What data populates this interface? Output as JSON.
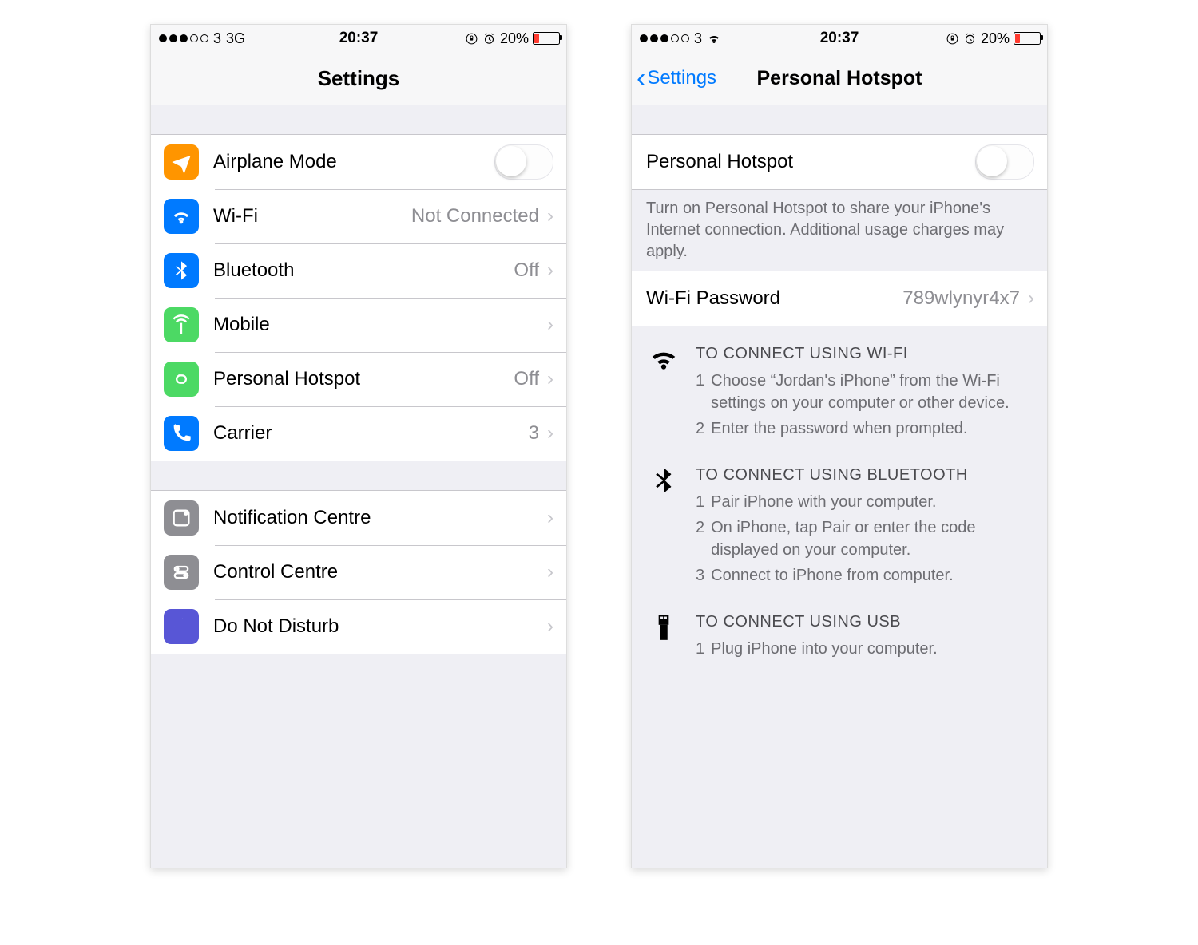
{
  "status": {
    "carrier": "3",
    "network": "3G",
    "time": "20:37",
    "battery_text": "20%"
  },
  "left": {
    "title": "Settings",
    "group1": [
      {
        "label": "Airplane Mode",
        "detail": "",
        "toggle": true
      },
      {
        "label": "Wi-Fi",
        "detail": "Not Connected"
      },
      {
        "label": "Bluetooth",
        "detail": "Off"
      },
      {
        "label": "Mobile",
        "detail": ""
      },
      {
        "label": "Personal Hotspot",
        "detail": "Off"
      },
      {
        "label": "Carrier",
        "detail": "3"
      }
    ],
    "group2": [
      {
        "label": "Notification Centre"
      },
      {
        "label": "Control Centre"
      },
      {
        "label": "Do Not Disturb"
      }
    ]
  },
  "right": {
    "back": "Settings",
    "title": "Personal Hotspot",
    "toggle_row": "Personal Hotspot",
    "footer": "Turn on Personal Hotspot to share your iPhone's Internet connection. Additional usage charges may apply.",
    "wifi_pw_label": "Wi-Fi Password",
    "wifi_pw_value": "789wlynyr4x7",
    "instr": {
      "wifi": {
        "title": "TO CONNECT USING WI-FI",
        "s1": "Choose “Jordan's iPhone” from the Wi-Fi settings on your computer or other device.",
        "s2": "Enter the password when prompted."
      },
      "bt": {
        "title": "TO CONNECT USING BLUETOOTH",
        "s1": "Pair iPhone with your computer.",
        "s2": "On iPhone, tap Pair or enter the code displayed on your computer.",
        "s3": "Connect to iPhone from computer."
      },
      "usb": {
        "title": "TO CONNECT USING USB",
        "s1": "Plug iPhone into your computer."
      }
    }
  }
}
